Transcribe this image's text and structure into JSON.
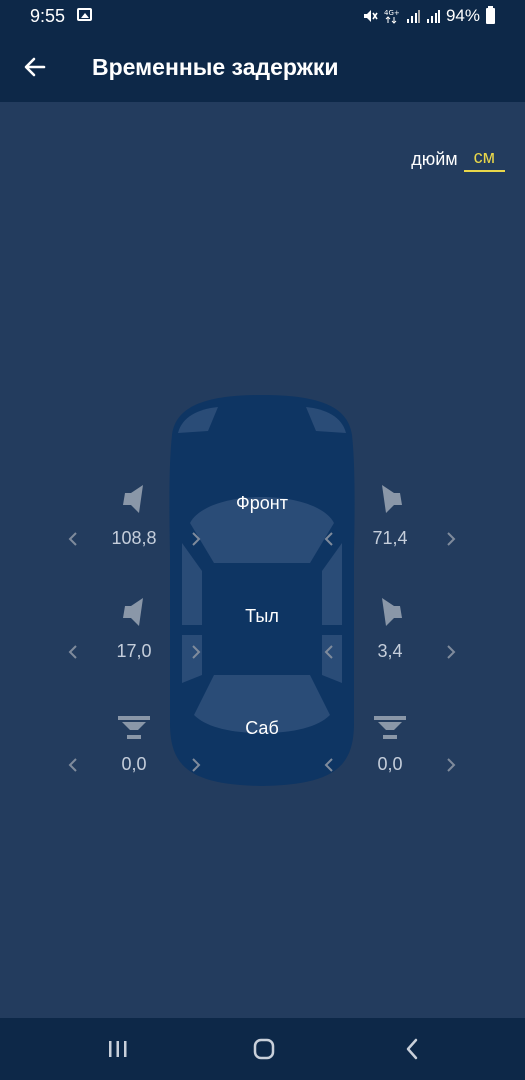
{
  "status": {
    "time": "9:55",
    "battery": "94%"
  },
  "header": {
    "title": "Временные задержки",
    "back_icon": "arrow-left-icon"
  },
  "units": {
    "inch_label": "дюйм",
    "cm_label": "см",
    "selected": "см"
  },
  "zones": {
    "front_label": "Фронт",
    "rear_label": "Тыл",
    "sub_label": "Саб"
  },
  "speakers": {
    "front_left": "108,8",
    "front_right": "71,4",
    "rear_left": "17,0",
    "rear_right": "3,4",
    "sub_left": "0,0",
    "sub_right": "0,0"
  },
  "colors": {
    "accent": "#e9d74a",
    "background": "#233c5e",
    "bar": "#0d2848",
    "car": "#0e3563"
  }
}
